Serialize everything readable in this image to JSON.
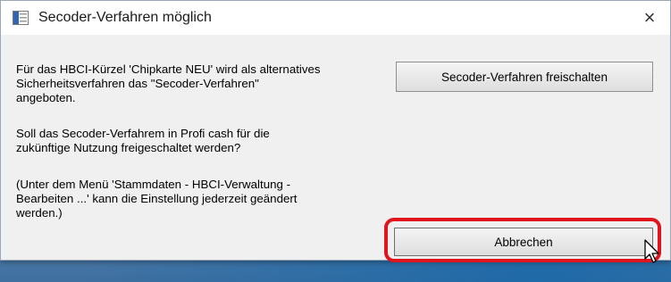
{
  "dialog": {
    "title": "Secoder-Verfahren möglich",
    "close_glyph": "×",
    "message_1": "Für das HBCI-Kürzel 'Chipkarte NEU' wird als alternatives\nSicherheitsverfahren  das \"Secoder-Verfahren\"\nangeboten.",
    "message_2": "Soll das Secoder-Verfahrem in Profi cash für die\nzukünftige Nutzung freigeschaltet werden?",
    "message_3": " (Unter dem Menü 'Stammdaten - HBCI-Verwaltung -\nBearbeiten ...' kann die Einstellung jederzeit geändert\nwerden.)",
    "unlock_button_label": "Secoder-Verfahren freischalten",
    "cancel_button_label": "Abbrechen"
  },
  "colors": {
    "highlight_ring": "#e0141c",
    "dialog_background": "#f0f0f0"
  },
  "icons": {
    "app": "app-window-icon",
    "cursor": "mouse-pointer-icon"
  }
}
